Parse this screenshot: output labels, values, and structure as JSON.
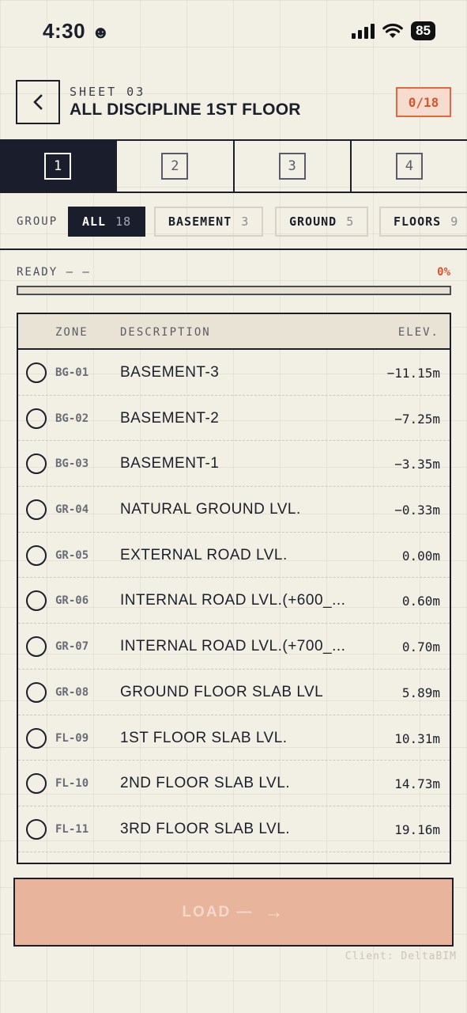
{
  "status_bar": {
    "time": "4:30",
    "battery": "85"
  },
  "header": {
    "sheet_label": "SHEET 03",
    "title": "ALL DISCIPLINE 1ST FLOOR",
    "count": "0/18"
  },
  "level_tabs": [
    {
      "label": "1",
      "active": true
    },
    {
      "label": "2",
      "active": false
    },
    {
      "label": "3",
      "active": false
    },
    {
      "label": "4",
      "active": false
    }
  ],
  "group_filter": {
    "label": "GROUP",
    "chips": [
      {
        "label": "ALL",
        "count": "18",
        "active": true
      },
      {
        "label": "BASEMENT",
        "count": "3",
        "active": false
      },
      {
        "label": "GROUND",
        "count": "5",
        "active": false
      },
      {
        "label": "FLOORS",
        "count": "9",
        "active": false
      }
    ]
  },
  "progress": {
    "label": "READY — —",
    "percent_text": "0%",
    "fraction": 0
  },
  "table": {
    "columns": {
      "zone": "ZONE",
      "description": "DESCRIPTION",
      "elevation": "ELEV."
    },
    "rows": [
      {
        "zone": "BG-01",
        "description": "BASEMENT-3",
        "elevation": "−11.15m"
      },
      {
        "zone": "BG-02",
        "description": "BASEMENT-2",
        "elevation": "−7.25m"
      },
      {
        "zone": "BG-03",
        "description": "BASEMENT-1",
        "elevation": "−3.35m"
      },
      {
        "zone": "GR-04",
        "description": "NATURAL GROUND LVL.",
        "elevation": "−0.33m"
      },
      {
        "zone": "GR-05",
        "description": "EXTERNAL ROAD LVL.",
        "elevation": "0.00m"
      },
      {
        "zone": "GR-06",
        "description": "INTERNAL ROAD LVL.(+600_...",
        "elevation": "0.60m"
      },
      {
        "zone": "GR-07",
        "description": "INTERNAL ROAD LVL.(+700_...",
        "elevation": "0.70m"
      },
      {
        "zone": "GR-08",
        "description": "GROUND FLOOR SLAB LVL",
        "elevation": "5.89m"
      },
      {
        "zone": "FL-09",
        "description": "1ST FLOOR SLAB LVL.",
        "elevation": "10.31m"
      },
      {
        "zone": "FL-10",
        "description": "2ND FLOOR SLAB LVL.",
        "elevation": "14.73m"
      },
      {
        "zone": "FL-11",
        "description": "3RD FLOOR SLAB LVL.",
        "elevation": "19.16m"
      }
    ]
  },
  "load_button": {
    "label": "LOAD —",
    "arrow": "→"
  },
  "footer": {
    "client": "Client: DeltaBIM"
  },
  "colors": {
    "accent": "#e0683f",
    "dark": "#1a1e2c",
    "background": "#f2efe4"
  }
}
